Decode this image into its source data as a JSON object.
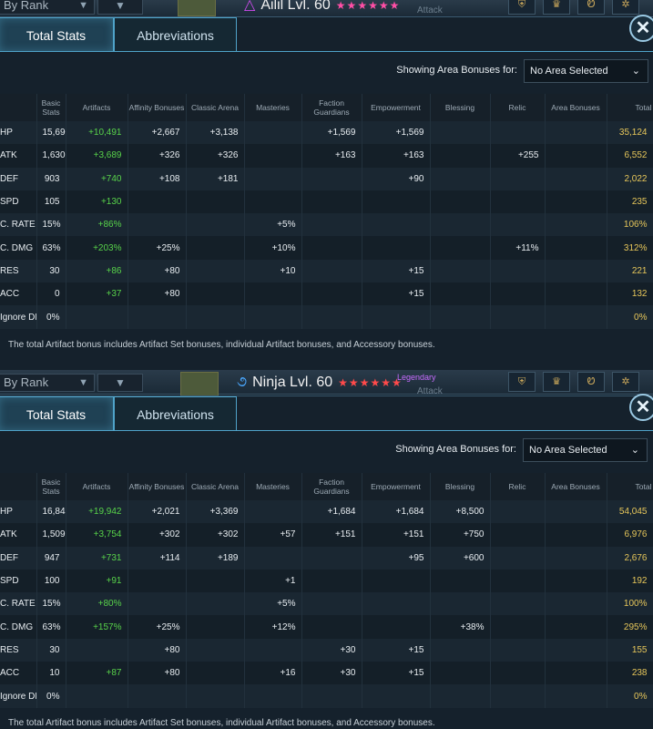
{
  "colors": {
    "artifact_green": "#58d34a",
    "total_gold": "#e6c65a",
    "tab_border": "#4fa3c9"
  },
  "topbar": {
    "rank_label": "By Rank",
    "filter_icon": "funnel-icon",
    "gear_icons": [
      "chest-armor-icon",
      "helmet-icon",
      "swirl-icon",
      "gear-icon"
    ]
  },
  "tabs": {
    "total_stats": "Total Stats",
    "abbreviations": "Abbreviations"
  },
  "area_bonus": {
    "label": "Showing Area Bonuses for:",
    "selected": "No Area Selected"
  },
  "headers": [
    "",
    "Basic Stats",
    "Artifacts",
    "Affinity Bonuses",
    "Classic Arena",
    "Masteries",
    "Faction Guardians",
    "Empowerment",
    "Blessing",
    "Relic",
    "Area Bonuses",
    "Total"
  ],
  "footnote": "The total Artifact bonus includes Artifact Set bonuses, individual Artifact bonuses, and Accessory bonuses.",
  "panels": [
    {
      "champion": {
        "name": "Ailil Lvl. 60",
        "stars": "★★★★★★",
        "affinity_icon": "triangle-affinity-icon"
      },
      "rarity": "",
      "role": "Attack",
      "rows": [
        [
          "HP",
          "15,690",
          "+10,491",
          "+2,667",
          "+3,138",
          "",
          "+1,569",
          "+1,569",
          "",
          "",
          "",
          "35,124"
        ],
        [
          "ATK",
          "1,630",
          "+3,689",
          "+326",
          "+326",
          "",
          "+163",
          "+163",
          "",
          "+255",
          "",
          "6,552"
        ],
        [
          "DEF",
          "903",
          "+740",
          "+108",
          "+181",
          "",
          "",
          "+90",
          "",
          "",
          "",
          "2,022"
        ],
        [
          "SPD",
          "105",
          "+130",
          "",
          "",
          "",
          "",
          "",
          "",
          "",
          "",
          "235"
        ],
        [
          "C. RATE",
          "15%",
          "+86%",
          "",
          "",
          "+5%",
          "",
          "",
          "",
          "",
          "",
          "106%"
        ],
        [
          "C. DMG",
          "63%",
          "+203%",
          "+25%",
          "",
          "+10%",
          "",
          "",
          "",
          "+11%",
          "",
          "312%"
        ],
        [
          "RES",
          "30",
          "+86",
          "+80",
          "",
          "+10",
          "",
          "+15",
          "",
          "",
          "",
          "221"
        ],
        [
          "ACC",
          "0",
          "+37",
          "+80",
          "",
          "",
          "",
          "+15",
          "",
          "",
          "",
          "132"
        ],
        [
          "Ignore DEF",
          "0%",
          "",
          "",
          "",
          "",
          "",
          "",
          "",
          "",
          "",
          "0%"
        ]
      ]
    },
    {
      "champion": {
        "name": "Ninja Lvl. 60",
        "stars": "★★★★★★",
        "affinity_icon": "void-swirl-affinity-icon"
      },
      "rarity": "Legendary",
      "role": "Attack",
      "rows": [
        [
          "HP",
          "16,845",
          "+19,942",
          "+2,021",
          "+3,369",
          "",
          "+1,684",
          "+1,684",
          "+8,500",
          "",
          "",
          "54,045"
        ],
        [
          "ATK",
          "1,509",
          "+3,754",
          "+302",
          "+302",
          "+57",
          "+151",
          "+151",
          "+750",
          "",
          "",
          "6,976"
        ],
        [
          "DEF",
          "947",
          "+731",
          "+114",
          "+189",
          "",
          "",
          "+95",
          "+600",
          "",
          "",
          "2,676"
        ],
        [
          "SPD",
          "100",
          "+91",
          "",
          "",
          "+1",
          "",
          "",
          "",
          "",
          "",
          "192"
        ],
        [
          "C. RATE",
          "15%",
          "+80%",
          "",
          "",
          "+5%",
          "",
          "",
          "",
          "",
          "",
          "100%"
        ],
        [
          "C. DMG",
          "63%",
          "+157%",
          "+25%",
          "",
          "+12%",
          "",
          "",
          "+38%",
          "",
          "",
          "295%"
        ],
        [
          "RES",
          "30",
          "",
          "+80",
          "",
          "",
          "+30",
          "+15",
          "",
          "",
          "",
          "155"
        ],
        [
          "ACC",
          "10",
          "+87",
          "+80",
          "",
          "+16",
          "+30",
          "+15",
          "",
          "",
          "",
          "238"
        ],
        [
          "Ignore DEF",
          "0%",
          "",
          "",
          "",
          "",
          "",
          "",
          "",
          "",
          "",
          "0%"
        ]
      ]
    }
  ]
}
